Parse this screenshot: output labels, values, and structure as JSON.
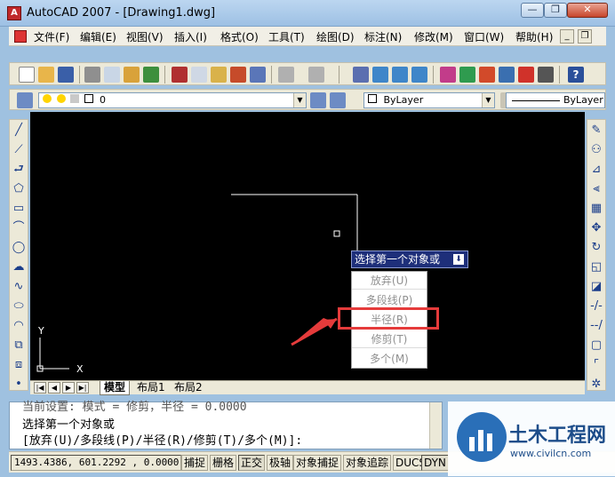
{
  "window": {
    "title": "AutoCAD 2007 - [Drawing1.dwg]",
    "minimize_label": "—",
    "restore_label": "❐",
    "close_label": "✕"
  },
  "menu": {
    "items": [
      "文件(F)",
      "编辑(E)",
      "视图(V)",
      "插入(I)",
      "格式(O)",
      "工具(T)",
      "绘图(D)",
      "标注(N)",
      "修改(M)",
      "窗口(W)",
      "帮助(H)"
    ],
    "mdi_minimize": "_",
    "mdi_restore": "❐"
  },
  "layer_toolbar": {
    "layer_value": "0",
    "color_value": "ByLayer",
    "linetype_value": "ByLayer"
  },
  "canvas": {
    "background": "#000000",
    "prompt_text": "选择第一个对象或",
    "dynamic_menu": [
      "放弃(U)",
      "多段线(P)",
      "半径(R)",
      "修剪(T)",
      "多个(M)"
    ],
    "highlighted_option": "半径(R)",
    "highlight_color": "#e53b3b",
    "ucs_x_label": "X",
    "ucs_y_label": "Y"
  },
  "tabs": {
    "items": [
      "模型",
      "布局1",
      "布局2"
    ],
    "active": "模型"
  },
  "command_line": {
    "line1": "当前设置: 模式 = 修剪，半径 = 0.0000",
    "line2": "选择第一个对象或",
    "line3": "[放弃(U)/多段线(P)/半径(R)/修剪(T)/多个(M)]:"
  },
  "status": {
    "coordinates": "1493.4386, 601.2292 , 0.0000",
    "toggles": [
      {
        "label": "捕捉",
        "on": false
      },
      {
        "label": "栅格",
        "on": false
      },
      {
        "label": "正交",
        "on": true
      },
      {
        "label": "极轴",
        "on": false
      },
      {
        "label": "对象捕捉",
        "on": false
      },
      {
        "label": "对象追踪",
        "on": false
      },
      {
        "label": "DUCS",
        "on": false
      },
      {
        "label": "DYN",
        "on": true
      }
    ]
  },
  "watermark": {
    "title": "土木工程网",
    "url": "www.civilcn.com"
  }
}
